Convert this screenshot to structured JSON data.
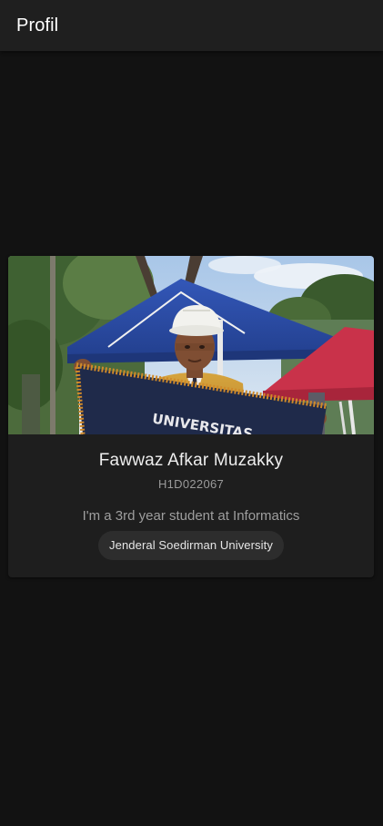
{
  "toolbar": {
    "title": "Profil"
  },
  "profile": {
    "photo_icon": "profile-photo",
    "name": "Fawwaz Afkar Muzakky",
    "student_id": "H1D022067",
    "description": "I'm a 3rd year student at Informatics",
    "university": "Jenderal Soedirman University",
    "photo_banner_text": "UNIVERSITAS"
  },
  "colors": {
    "background": "#121212",
    "toolbar": "#1f1f1f",
    "card": "#1e1e1e",
    "chip": "#2d2d2d",
    "text_primary": "#eeeeee",
    "text_secondary": "#9e9e9e"
  }
}
